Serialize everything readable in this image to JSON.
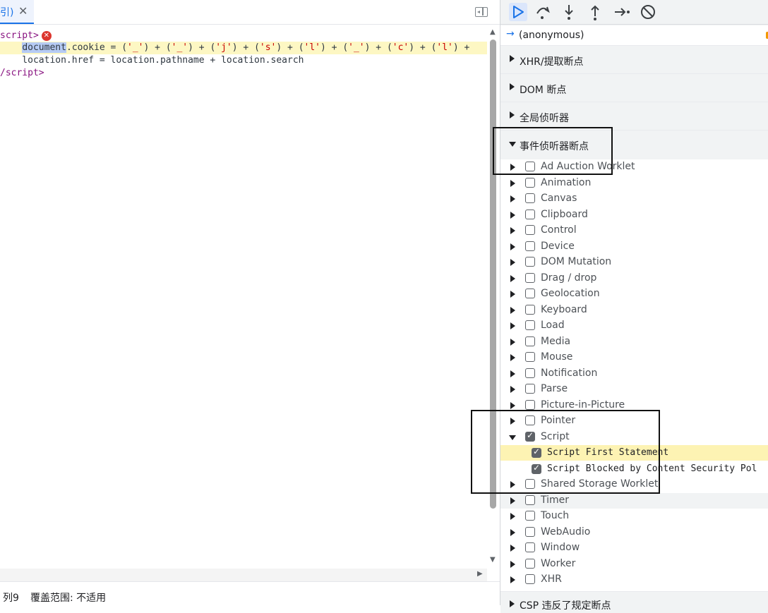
{
  "editor": {
    "tab_label": "引)",
    "tab_close_glyph": "✕",
    "lines": {
      "l1_tag": "script>",
      "l2_selected": "document",
      "l2_rest_a": ".cookie = (",
      "l2_s1": "'_'",
      "l2_p1": ") + (",
      "l2_s2": "'_'",
      "l2_p2": ") + (",
      "l2_s3": "'j'",
      "l2_p3": ") + (",
      "l2_s4": "'s'",
      "l2_p4": ") + (",
      "l2_s5": "'l'",
      "l2_p5": ") + (",
      "l2_s6": "'_'",
      "l2_p6": ") + (",
      "l2_s7": "'c'",
      "l2_p7": ") + (",
      "l2_s8": "'l'",
      "l2_p8": ") +",
      "l3": "    location.href = location.pathname + location.search",
      "l4_tag": "/script>"
    },
    "error_badge": "✕"
  },
  "status": {
    "column": "列9",
    "coverage": "覆盖范围: 不适用"
  },
  "debugger": {
    "callstack_item": "(anonymous)",
    "sections": {
      "xhr": "XHR/提取断点",
      "dom": "DOM 断点",
      "global": "全局侦听器",
      "event": "事件侦听器断点",
      "csp": "CSP 违反了规定断点"
    },
    "events": [
      {
        "label": "Ad Auction Worklet",
        "checked": false
      },
      {
        "label": "Animation",
        "checked": false
      },
      {
        "label": "Canvas",
        "checked": false
      },
      {
        "label": "Clipboard",
        "checked": false
      },
      {
        "label": "Control",
        "checked": false
      },
      {
        "label": "Device",
        "checked": false
      },
      {
        "label": "DOM Mutation",
        "checked": false
      },
      {
        "label": "Drag / drop",
        "checked": false
      },
      {
        "label": "Geolocation",
        "checked": false
      },
      {
        "label": "Keyboard",
        "checked": false
      },
      {
        "label": "Load",
        "checked": false
      },
      {
        "label": "Media",
        "checked": false
      },
      {
        "label": "Mouse",
        "checked": false
      },
      {
        "label": "Notification",
        "checked": false
      },
      {
        "label": "Parse",
        "checked": false
      },
      {
        "label": "Picture-in-Picture",
        "checked": false
      },
      {
        "label": "Pointer",
        "checked": false
      },
      {
        "label": "Script",
        "checked": true
      },
      {
        "label": "Shared Storage Worklet",
        "checked": false
      },
      {
        "label": "Timer",
        "checked": false
      },
      {
        "label": "Touch",
        "checked": false
      },
      {
        "label": "WebAudio",
        "checked": false
      },
      {
        "label": "Window",
        "checked": false
      },
      {
        "label": "Worker",
        "checked": false
      },
      {
        "label": "XHR",
        "checked": false
      }
    ],
    "script_sub": {
      "first": "Script First Statement",
      "blocked": "Script Blocked by Content Security Pol"
    }
  },
  "icons": {
    "resume": "resume-icon",
    "step_over": "step-over-icon",
    "step_into": "step-into-icon",
    "step_out": "step-out-icon",
    "step": "step-icon",
    "deactivate": "deactivate-breakpoints-icon"
  },
  "colors": {
    "accent": "#1a73e8",
    "execution_line": "#fdf7c3",
    "selected_token": "#b6cbf4",
    "error": "#dc362e"
  }
}
